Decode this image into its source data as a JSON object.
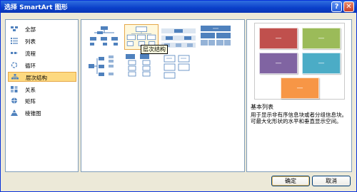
{
  "titlebar": {
    "title": "选择 SmartArt 图形",
    "help": "?",
    "close": "✕"
  },
  "categories": [
    {
      "label": "全部",
      "icon": "all-icon"
    },
    {
      "label": "列表",
      "icon": "list-icon"
    },
    {
      "label": "流程",
      "icon": "process-icon"
    },
    {
      "label": "循环",
      "icon": "cycle-icon"
    },
    {
      "label": "层次结构",
      "icon": "hierarchy-icon"
    },
    {
      "label": "关系",
      "icon": "relationship-icon"
    },
    {
      "label": "矩阵",
      "icon": "matrix-icon"
    },
    {
      "label": "棱锥图",
      "icon": "pyramid-icon"
    }
  ],
  "selected_category": "层次结构",
  "tooltip": "层次结构",
  "preview": {
    "title": "基本列表",
    "description": "用于显示非有序信息块或者分组信息块。可最大化形状的水平和垂直显示空间。",
    "swatches": [
      {
        "label": "—",
        "color": "#c0504d"
      },
      {
        "label": "—",
        "color": "#9bbb59"
      },
      {
        "label": "—",
        "color": "#8064a2"
      },
      {
        "label": "—",
        "color": "#4bacc6"
      },
      {
        "label": "—",
        "color": "#f79646"
      }
    ]
  },
  "buttons": {
    "ok": "确定",
    "cancel": "取消"
  },
  "colors": {
    "accent": "#4f81bd",
    "selection": "#fdd980",
    "title_bar": "#0a3fc9"
  }
}
